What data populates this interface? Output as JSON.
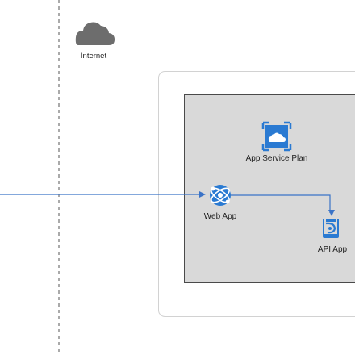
{
  "diagram": {
    "internet_label": "Internet",
    "app_service_plan_label": "App Service Plan",
    "web_app_label": "Web App",
    "api_app_label": "API App"
  },
  "colors": {
    "connector": "#3a73c7",
    "icon_blue": "#2a7ad2",
    "cloud_gray": "#6d6d6d",
    "plan_fill": "#d9d9d9",
    "plan_border": "#4a4a4a",
    "outer_border": "#d2d2d2",
    "boundary_line": "#555555"
  },
  "icons": {
    "internet": "cloud-icon",
    "app_service_plan": "app-service-plan-icon",
    "web_app": "web-app-icon",
    "api_app": "api-app-icon"
  }
}
